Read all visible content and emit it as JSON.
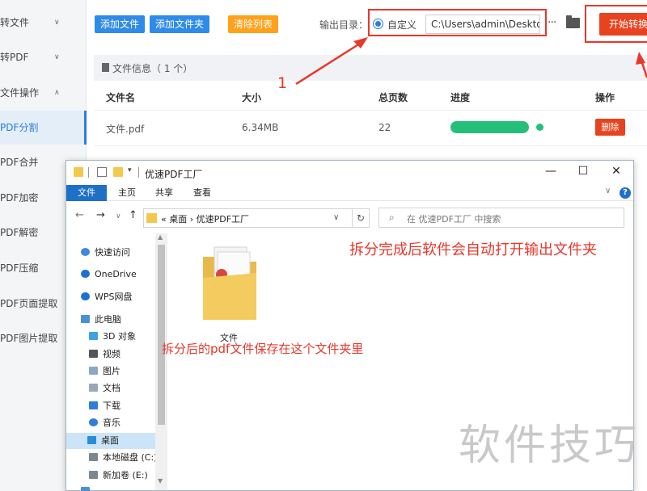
{
  "sidebar": {
    "items": [
      {
        "label": "转文件",
        "expandable": true
      },
      {
        "label": "转PDF",
        "expandable": true
      },
      {
        "label": "文件操作",
        "expandable": true,
        "expanded": true
      },
      {
        "label": "PDF分割",
        "active": true
      },
      {
        "label": "PDF合并"
      },
      {
        "label": "PDF加密"
      },
      {
        "label": "PDF解密"
      },
      {
        "label": "PDF压缩"
      },
      {
        "label": "PDF页面提取"
      },
      {
        "label": "PDF图片提取"
      }
    ]
  },
  "toolbar": {
    "add_file": "添加文件",
    "add_folder": "添加文件夹",
    "clear_list": "清除列表",
    "output_label": "输出目录：",
    "custom_option": "自定义",
    "output_path": "C:\\Users\\admin\\Deskto",
    "start_button": "开始转换",
    "more": "···"
  },
  "file_panel": {
    "info": "文件信息（ 1 个）",
    "columns": [
      "文件名",
      "大小",
      "总页数",
      "进度",
      "操作"
    ],
    "rows": [
      {
        "name": "文件.pdf",
        "size": "6.34MB",
        "pages": "22",
        "progress": 1.0,
        "action": "删除"
      }
    ]
  },
  "annotations": {
    "step_number": "1",
    "auto_open_note": "拆分完成后软件会自动打开输出文件夹",
    "saved_note": "拆分后的pdf文件保存在这个文件夹里"
  },
  "explorer": {
    "title": "优速PDF工厂",
    "ribbon_tabs": [
      "文件",
      "主页",
      "共享",
      "查看"
    ],
    "address": "« 桌面 › 优速PDF工厂",
    "search_placeholder": "在 优速PDF工厂 中搜索",
    "nav_items": [
      {
        "label": "快速访问",
        "icon": "star-icon"
      },
      {
        "label": "OneDrive",
        "icon": "cloud-icon"
      },
      {
        "label": "WPS网盘",
        "icon": "cloud-icon"
      },
      {
        "label": "此电脑",
        "icon": "computer-icon"
      },
      {
        "label": "3D 对象",
        "icon": "cube-icon"
      },
      {
        "label": "视频",
        "icon": "video-icon"
      },
      {
        "label": "图片",
        "icon": "picture-icon"
      },
      {
        "label": "文档",
        "icon": "document-icon"
      },
      {
        "label": "下载",
        "icon": "download-icon"
      },
      {
        "label": "音乐",
        "icon": "music-icon"
      },
      {
        "label": "桌面",
        "icon": "desktop-icon",
        "selected": true
      },
      {
        "label": "本地磁盘 (C:)",
        "icon": "drive-icon"
      },
      {
        "label": "新加卷 (E:)",
        "icon": "drive-icon"
      },
      {
        "label": "...",
        "icon": "network-icon"
      }
    ],
    "folder_item": "文件"
  },
  "watermark": "软件技巧",
  "colors": {
    "accent_blue": "#2f8be8",
    "orange": "#ffa11a",
    "red": "#e8431f",
    "annotation_red": "#e8372b",
    "progress_green": "#24c07a"
  }
}
